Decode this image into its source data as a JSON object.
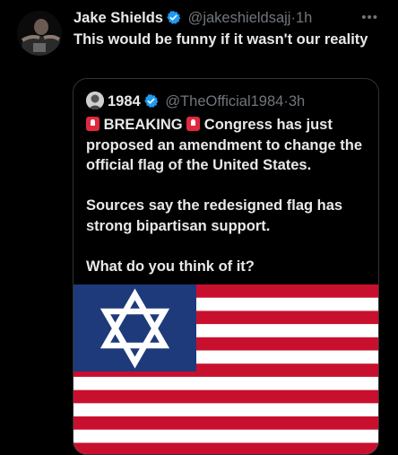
{
  "tweet": {
    "author_name": "Jake Shields",
    "handle": "@jakeshieldsajj",
    "separator": "·",
    "time": "1h",
    "more_icon": "more-horizontal-icon",
    "text": "This would be funny if it wasn't our reality"
  },
  "quote": {
    "author_name": "1984",
    "handle": "@TheOfficial1984",
    "separator": "·",
    "time": "3h",
    "breaking": "BREAKING",
    "line1_rest": "Congress has just proposed an amendment to change the official flag of the United States.",
    "para2": "Sources say the redesigned flag has strong bipartisan support.",
    "para3": "What do you think of it?",
    "siren_icon": "police-siren-emoji"
  },
  "colors": {
    "verified": "#1d9bf0",
    "flag_blue": "#1f3a7a",
    "flag_red": "#c8102e",
    "flag_white": "#ffffff"
  }
}
